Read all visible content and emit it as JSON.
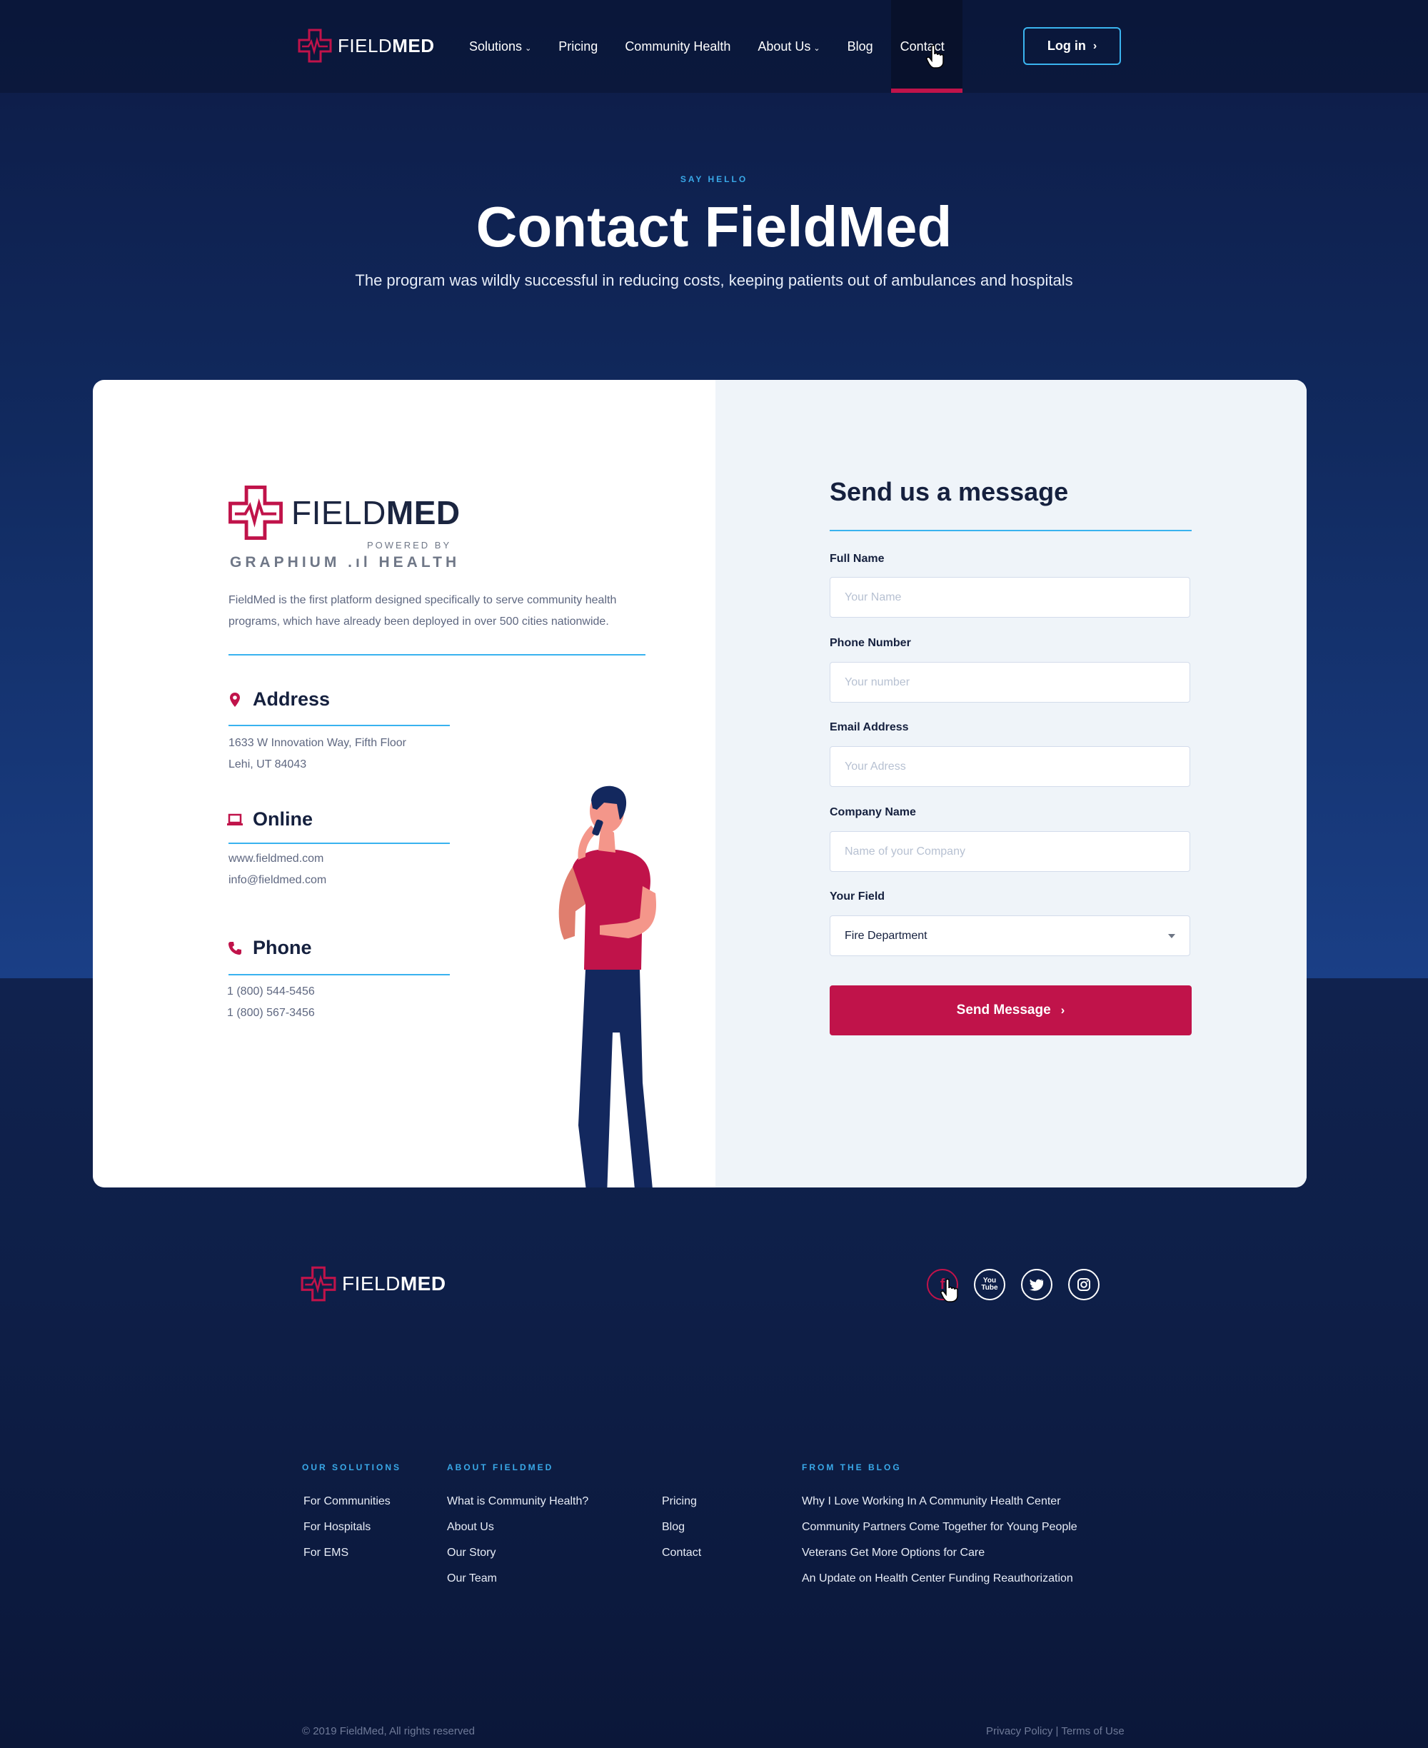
{
  "brand": {
    "name_light": "FIELD",
    "name_bold": "MED",
    "accent": "#c0134a",
    "blue": "#39b2ef"
  },
  "nav": {
    "items": [
      {
        "label": "Solutions",
        "dropdown": true
      },
      {
        "label": "Pricing"
      },
      {
        "label": "Community Health"
      },
      {
        "label": "About Us",
        "dropdown": true
      },
      {
        "label": "Blog"
      },
      {
        "label": "Contact",
        "active": true
      }
    ],
    "login_label": "Log in"
  },
  "hero": {
    "eyebrow": "SAY HELLO",
    "title": "Contact FieldMed",
    "subtitle": "The program was wildly successful in reducing costs, keeping patients out of ambulances and hospitals"
  },
  "contact": {
    "powered_by": "POWERED BY",
    "partner": "GRAPHIUM .ıl HEALTH",
    "description": "FieldMed is the first platform designed specifically to serve community health programs, which have already been deployed in over 500 cities nationwide.",
    "address": {
      "title": "Address",
      "line1": "1633 W Innovation Way, Fifth Floor",
      "line2": "Lehi, UT 84043"
    },
    "online": {
      "title": "Online",
      "line1": "www.fieldmed.com",
      "line2": "info@fieldmed.com"
    },
    "phone": {
      "title": "Phone",
      "line1": "1 (800) 544-5456",
      "line2": "1 (800) 567-3456"
    }
  },
  "form": {
    "title": "Send us a message",
    "full_name": {
      "label": "Full Name",
      "placeholder": "Your Name"
    },
    "phone": {
      "label": "Phone Number",
      "placeholder": "Your number"
    },
    "email": {
      "label": "Email Address",
      "placeholder": "Your Adress"
    },
    "company": {
      "label": "Company Name",
      "placeholder": "Name of your Company"
    },
    "field": {
      "label": "Your Field",
      "value": "Fire Department"
    },
    "submit_label": "Send Message"
  },
  "footer": {
    "social": [
      "facebook-icon",
      "youtube-icon",
      "twitter-icon",
      "instagram-icon"
    ],
    "social_labels": {
      "youtube": "You Tube"
    },
    "solutions": {
      "heading": "OUR SOLUTIONS",
      "links": [
        "For Communities",
        "For Hospitals",
        "For EMS"
      ]
    },
    "about": {
      "heading": "ABOUT FIELDMED",
      "links": [
        "What is Community Health?",
        "About Us",
        "Our Story",
        "Our Team"
      ],
      "links2": [
        "Pricing",
        "Blog",
        "Contact"
      ]
    },
    "blog": {
      "heading": "FROM THE BLOG",
      "links": [
        "Why I Love Working In A Community Health Center",
        "Community Partners Come Together for Young People",
        "Veterans Get More Options for Care",
        "An Update on Health Center Funding Reauthorization"
      ]
    },
    "copyright": "© 2019 FieldMed, All rights reserved",
    "privacy": "Privacy Policy",
    "separator": "|",
    "terms": "Terms of Use"
  }
}
